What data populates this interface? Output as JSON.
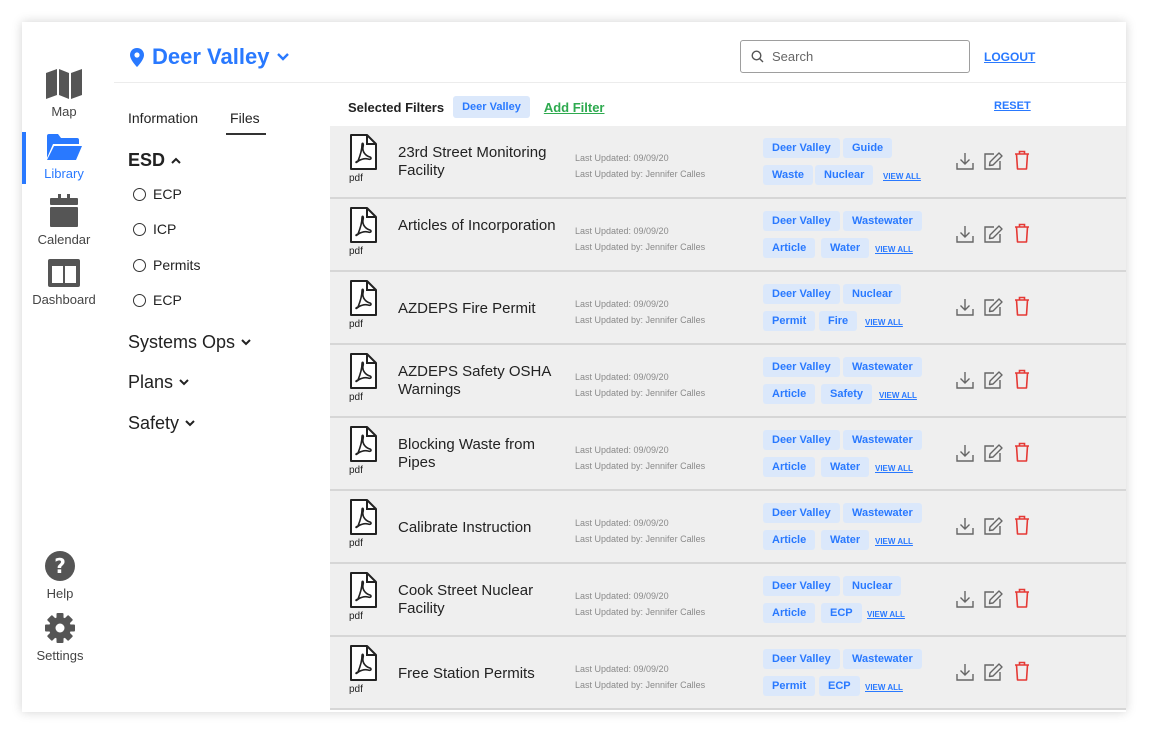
{
  "app": {
    "location": "Deer Valley",
    "search_placeholder": "Search",
    "logout_label": "LOGOUT"
  },
  "rail": {
    "items": [
      {
        "label": "Map",
        "icon": "map-icon"
      },
      {
        "label": "Library",
        "icon": "folder-icon",
        "active": true
      },
      {
        "label": "Calendar",
        "icon": "calendar-icon"
      },
      {
        "label": "Dashboard",
        "icon": "dashboard-icon"
      }
    ],
    "bottom": [
      {
        "label": "Help",
        "icon": "help-icon"
      },
      {
        "label": "Settings",
        "icon": "gear-icon"
      }
    ]
  },
  "nav": {
    "tabs": [
      "Information",
      "Files"
    ],
    "active_tab": "Files",
    "esd": {
      "label": "ESD",
      "items": [
        "ECP",
        "ICP",
        "Permits",
        "ECP"
      ]
    },
    "categories": [
      "Systems Ops",
      "Plans",
      "Safety"
    ]
  },
  "filters": {
    "label": "Selected Filters",
    "selected": [
      "Deer Valley"
    ],
    "add_label": "Add Filter",
    "reset_label": "RESET"
  },
  "files": [
    {
      "name": "23rd Street Monitoring Facility",
      "updated": "Last Updated:  09/09/20",
      "updated_by": "Last Updated by: Jennifer Calles",
      "tags": [
        "Deer Valley",
        "Guide",
        "Waste",
        "Nuclear"
      ],
      "view_all": "VIEW ALL",
      "type_label": "pdf"
    },
    {
      "name": "Articles of Incorporation",
      "updated": "Last Updated:  09/09/20",
      "updated_by": "Last Updated by: Jennifer Calles",
      "tags": [
        "Deer Valley",
        "Wastewater",
        "Article",
        "Water"
      ],
      "view_all": "VIEW ALL",
      "type_label": "pdf"
    },
    {
      "name": "AZDEPS Fire Permit",
      "updated": "Last Updated:  09/09/20",
      "updated_by": "Last Updated by: Jennifer Calles",
      "tags": [
        "Deer Valley",
        "Nuclear",
        "Permit",
        "Fire"
      ],
      "view_all": "VIEW ALL",
      "type_label": "pdf"
    },
    {
      "name": "AZDEPS Safety OSHA Warnings",
      "updated": "Last Updated:  09/09/20",
      "updated_by": "Last Updated by: Jennifer Calles",
      "tags": [
        "Deer Valley",
        "Wastewater",
        "Article",
        "Safety"
      ],
      "view_all": "VIEW ALL",
      "type_label": "pdf"
    },
    {
      "name": "Blocking Waste from Pipes",
      "updated": "Last Updated:  09/09/20",
      "updated_by": "Last Updated by: Jennifer Calles",
      "tags": [
        "Deer Valley",
        "Wastewater",
        "Article",
        "Water"
      ],
      "view_all": "VIEW ALL",
      "type_label": "pdf"
    },
    {
      "name": "Calibrate Instruction",
      "updated": "Last Updated:  09/09/20",
      "updated_by": "Last Updated by: Jennifer Calles",
      "tags": [
        "Deer Valley",
        "Wastewater",
        "Article",
        "Water"
      ],
      "view_all": "VIEW ALL",
      "type_label": "pdf"
    },
    {
      "name": "Cook Street Nuclear Facility",
      "updated": "Last Updated:  09/09/20",
      "updated_by": "Last Updated by: Jennifer Calles",
      "tags": [
        "Deer Valley",
        "Nuclear",
        "Article",
        "ECP"
      ],
      "view_all": "VIEW ALL",
      "type_label": "pdf"
    },
    {
      "name": "Free Station Permits",
      "updated": "Last Updated:  09/09/20",
      "updated_by": "Last Updated by: Jennifer Calles",
      "tags": [
        "Deer Valley",
        "Wastewater",
        "Permit",
        "ECP"
      ],
      "view_all": "VIEW ALL",
      "type_label": "pdf"
    }
  ],
  "colors": {
    "accent": "#2979ff",
    "add_filter": "#2eaa4f",
    "delete": "#e53935",
    "tag_bg": "#dbe8fb",
    "row_bg": "#efefef"
  }
}
